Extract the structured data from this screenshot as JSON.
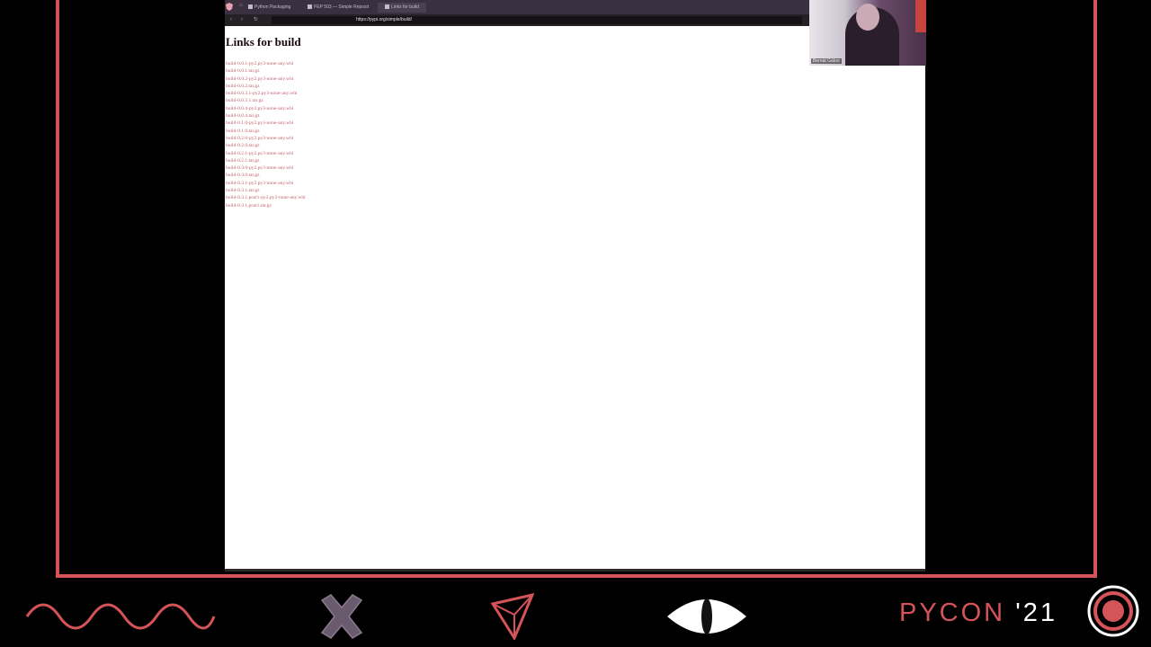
{
  "browser": {
    "tabs": [
      {
        "label": "Python Packaging"
      },
      {
        "label": "PEP 503 — Simple Reposit"
      },
      {
        "label": "Links for build"
      }
    ],
    "url": "https://pypi.org/simple/build/"
  },
  "page": {
    "title": "Links for build",
    "links": [
      "build-0.0.1-py2.py3-none-any.whl",
      "build-0.0.1.tar.gz",
      "build-0.0.2-py2.py3-none-any.whl",
      "build-0.0.2.tar.gz",
      "build-0.0.3.1-py2.py3-none-any.whl",
      "build-0.0.3.1.tar.gz",
      "build-0.0.4-py2.py3-none-any.whl",
      "build-0.0.4.tar.gz",
      "build-0.1.0-py2.py3-none-any.whl",
      "build-0.1.0.tar.gz",
      "build-0.2.0-py2.py3-none-any.whl",
      "build-0.2.0.tar.gz",
      "build-0.2.1-py2.py3-none-any.whl",
      "build-0.2.1.tar.gz",
      "build-0.3.0-py2.py3-none-any.whl",
      "build-0.3.0.tar.gz",
      "build-0.3.1-py2.py3-none-any.whl",
      "build-0.3.1.tar.gz",
      "build-0.3.1.post1-py2.py3-none-any.whl",
      "build-0.3.1.post1.tar.gz"
    ]
  },
  "webcam": {
    "label": "Bernát Gábor"
  },
  "branding": {
    "event_name": "PYCON",
    "event_year": "'21",
    "accent_color": "#d5545a",
    "icons": [
      "wave-icon",
      "cross-icon",
      "triangle-icon",
      "eye-icon",
      "target-icon"
    ]
  }
}
